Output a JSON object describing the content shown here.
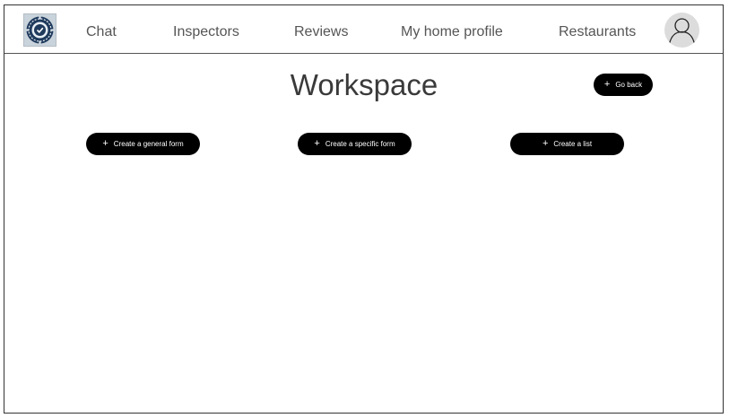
{
  "nav": {
    "logo_icon": "inspection-badge-icon",
    "links": [
      {
        "label": "Chat"
      },
      {
        "label": "Inspectors"
      },
      {
        "label": "Reviews"
      },
      {
        "label": "My home profile"
      },
      {
        "label": "Restaurants"
      }
    ],
    "avatar_icon": "user-avatar-icon"
  },
  "main": {
    "title": "Workspace",
    "go_back_label": "Go back",
    "actions": [
      {
        "label": "Create a general form",
        "icon": "plus-icon"
      },
      {
        "label": "Create a specific form",
        "icon": "plus-icon"
      },
      {
        "label": "Create a list",
        "icon": "plus-icon"
      }
    ]
  },
  "colors": {
    "button_bg": "#000000",
    "button_text": "#ffffff",
    "nav_text": "#555555",
    "title_text": "#3a3a3a"
  }
}
